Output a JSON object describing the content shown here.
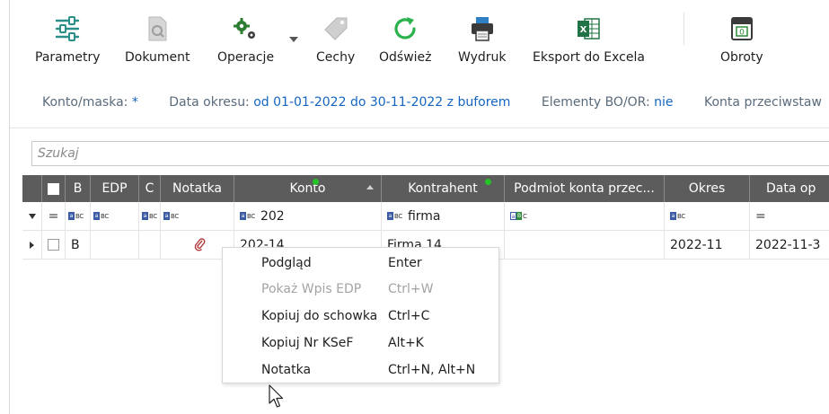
{
  "toolbar": {
    "parametry": "Parametry",
    "dokument": "Dokument",
    "operacje": "Operacje",
    "cechy": "Cechy",
    "odswiez": "Odśwież",
    "wydruk": "Wydruk",
    "eksport": "Eksport do Excela",
    "obroty": "Obroty"
  },
  "filters": {
    "konto_label": "Konto/maska:",
    "konto_value": "*",
    "data_label": "Data okresu:",
    "data_value": "od 01-01-2022 do 30-11-2022 z buforem",
    "elementy_label": "Elementy BO/OR:",
    "elementy_value": "nie",
    "konta_label": "Konta przeciwstaw"
  },
  "search": {
    "placeholder": "Szukaj"
  },
  "grid": {
    "headers": [
      "",
      "B",
      "EDP",
      "C",
      "Notatka",
      "Konto",
      "Kontrahent",
      "Podmiot konta przec...",
      "Okres",
      "Data op"
    ],
    "filter_row": {
      "equals": "=",
      "konto": "202",
      "kontrahent": "firma",
      "date_equals": "="
    },
    "row1": {
      "b": "B",
      "konto": "202-14",
      "kontrahent": "Firma 14",
      "okres": "2022-11",
      "data": "2022-11-3"
    }
  },
  "context_menu": {
    "items": [
      {
        "label": "Podgląd",
        "shortcut": "Enter"
      },
      {
        "label": "Pokaż Wpis EDP",
        "shortcut": "Ctrl+W"
      },
      {
        "label": "Kopiuj do schowka",
        "shortcut": "Ctrl+C"
      },
      {
        "label": "Kopiuj Nr KSeF",
        "shortcut": "Alt+K"
      },
      {
        "label": "Notatka",
        "shortcut": "Ctrl+N, Alt+N"
      }
    ]
  },
  "colors": {
    "accent_blue": "#1565c0",
    "header_gray": "#5c5c5c",
    "filter_green": "#25c228",
    "refresh_green": "#2bb24c",
    "excel_green": "#217346"
  }
}
